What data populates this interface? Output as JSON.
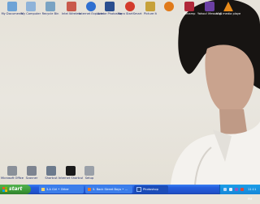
{
  "desktop": {
    "top_icons": [
      {
        "label": "My Documents",
        "icon": "documents-icon",
        "color": "#6ea3d6"
      },
      {
        "label": "My Computer",
        "icon": "computer-icon",
        "color": "#8fb3d9"
      },
      {
        "label": "Recycle Bin",
        "icon": "recycle-bin-icon",
        "color": "#7aa3c3"
      },
      {
        "label": "Intel Wireless",
        "icon": "wireless-icon",
        "color": "#c95a4c"
      },
      {
        "label": "Internet Explorer",
        "icon": "ie-icon",
        "color": "#2f6fd0"
      },
      {
        "label": "Adobe Photoshop",
        "icon": "photoshop-icon",
        "color": "#2a4e8f"
      },
      {
        "label": "Nero StartSmart",
        "icon": "nero-icon",
        "color": "#d33b2c"
      },
      {
        "label": "Picture It",
        "icon": "paint-icon",
        "color": "#c7a13a"
      },
      {
        "label": "",
        "icon": "ball-icon",
        "color": "#e07a1a"
      },
      {
        "label": "Winamp",
        "icon": "winamp-icon",
        "color": "#b0283a"
      },
      {
        "label": "Yahoo! Messenger",
        "icon": "messenger-icon",
        "color": "#6b3fa3"
      },
      {
        "label": "VLC media player",
        "icon": "vlc-icon",
        "color": "#e88a1a"
      }
    ],
    "bottom_icons": [
      {
        "label": "Microsoft Office",
        "icon": "printer-icon",
        "color": "#8a9099"
      },
      {
        "label": "Scanner",
        "icon": "scanner-icon",
        "color": "#7d8490"
      },
      {
        "label": "Shortcut",
        "icon": "app-icon",
        "color": "#6c7a8c"
      },
      {
        "label": "Internet Shortcut",
        "icon": "globe-icon",
        "color": "#1a1a1a"
      },
      {
        "label": "Setup",
        "icon": "setup-icon",
        "color": "#9aa0a8"
      }
    ]
  },
  "taskbar": {
    "start_label": "start",
    "tasks": [
      {
        "label": "3.A Girl • Other",
        "icon": "folder-icon"
      },
      {
        "label": "5. Back Street Boys • ...",
        "icon": "media-icon"
      },
      {
        "label": "Photoshop",
        "icon": "photoshop-task-icon"
      }
    ],
    "clock": "11:11 PM"
  },
  "colors": {
    "taskbar_blue": "#245edc",
    "start_green": "#3c9b38",
    "tray_blue": "#1487d8",
    "label_blue": "#1c2a6b"
  }
}
